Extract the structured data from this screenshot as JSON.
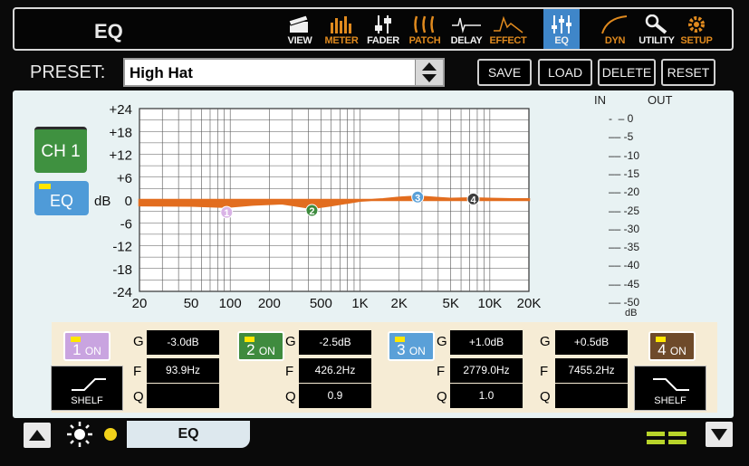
{
  "screen_title": "EQ",
  "nav": [
    {
      "label": "VIEW",
      "icon": "view-icon",
      "color": "#f0f0f0"
    },
    {
      "label": "METER",
      "icon": "meter-icon",
      "color": "#e08a1e"
    },
    {
      "label": "FADER",
      "icon": "fader-icon",
      "color": "#f0f0f0"
    },
    {
      "label": "PATCH",
      "icon": "patch-icon",
      "color": "#e08a1e"
    },
    {
      "label": "DELAY",
      "icon": "delay-icon",
      "color": "#f0f0f0"
    },
    {
      "label": "EFFECT",
      "icon": "effect-icon",
      "color": "#e08a1e"
    },
    {
      "label": "EQ",
      "icon": "eq-icon",
      "color": "#f0f0f0",
      "active": true
    },
    {
      "label": "DYN",
      "icon": "dyn-icon",
      "color": "#e08a1e"
    },
    {
      "label": "UTILITY",
      "icon": "utility-icon",
      "color": "#f0f0f0"
    },
    {
      "label": "SETUP",
      "icon": "setup-icon",
      "color": "#e08a1e"
    }
  ],
  "preset": {
    "label": "PRESET:",
    "value": "High Hat"
  },
  "buttons": {
    "save": "SAVE",
    "load": "LOAD",
    "delete": "DELETE",
    "reset": "RESET"
  },
  "channel": "CH 1",
  "eq_button": "EQ",
  "chart_data": {
    "type": "line",
    "ylabel": "dB",
    "y_ticks": [
      "+24",
      "+18",
      "+12",
      "+6",
      "0",
      "-6",
      "-12",
      "-18",
      "-24"
    ],
    "x_ticks": [
      "20",
      "50",
      "100",
      "200",
      "500",
      "1K",
      "2K",
      "5K",
      "10K",
      "20K"
    ],
    "xlim": [
      20,
      20000
    ],
    "ylim": [
      -24,
      24
    ],
    "x_scale": "log",
    "grid": true,
    "curve": {
      "x": [
        20,
        50,
        94,
        150,
        250,
        426,
        600,
        1000,
        1500,
        2000,
        2779,
        4000,
        5000,
        7455,
        10000,
        15000,
        20000
      ],
      "y": [
        -1.4,
        -1.5,
        -1.8,
        -1.2,
        -0.9,
        -2.1,
        -1.4,
        -0.2,
        0.2,
        0.6,
        0.9,
        0.5,
        0.3,
        0.4,
        0.3,
        0.2,
        0.2
      ]
    },
    "markers": [
      {
        "label": "1",
        "freq": 93.9,
        "gain": -3.0,
        "color": "#d9b3e6"
      },
      {
        "label": "2",
        "freq": 426.2,
        "gain": -2.5,
        "color": "#3c8b3d"
      },
      {
        "label": "3",
        "freq": 2779.0,
        "gain": 1.0,
        "color": "#5aa0d8"
      },
      {
        "label": "4",
        "freq": 7455.2,
        "gain": 0.5,
        "color": "#3e3e3e"
      }
    ],
    "fill_color": "#e26d1f"
  },
  "meter": {
    "in_label": "IN",
    "out_label": "OUT",
    "scale": [
      "0",
      "-5",
      "-10",
      "-15",
      "-20",
      "-25",
      "-30",
      "-35",
      "-40",
      "-45",
      "-50"
    ],
    "unit": "dB"
  },
  "bands": [
    {
      "button": "1",
      "on": "ON",
      "color": "#c9a4e0",
      "gain": "-3.0dB",
      "freq": "93.9Hz",
      "q": "",
      "shelf": "SHELF"
    },
    {
      "button": "2",
      "on": "ON",
      "color": "#3f8b3e",
      "gain": "-2.5dB",
      "freq": "426.2Hz",
      "q": "0.9"
    },
    {
      "button": "3",
      "on": "ON",
      "color": "#5aa0d8",
      "gain": "+1.0dB",
      "freq": "2779.0Hz",
      "q": "1.0"
    },
    {
      "button": "4",
      "on": "ON",
      "color": "#6e4a2a",
      "gain": "+0.5dB",
      "freq": "7455.2Hz",
      "q": "",
      "shelf": "SHELF"
    }
  ],
  "param_labels": {
    "g": "G",
    "f": "F",
    "q": "Q"
  },
  "bottom": {
    "tab": "EQ"
  }
}
